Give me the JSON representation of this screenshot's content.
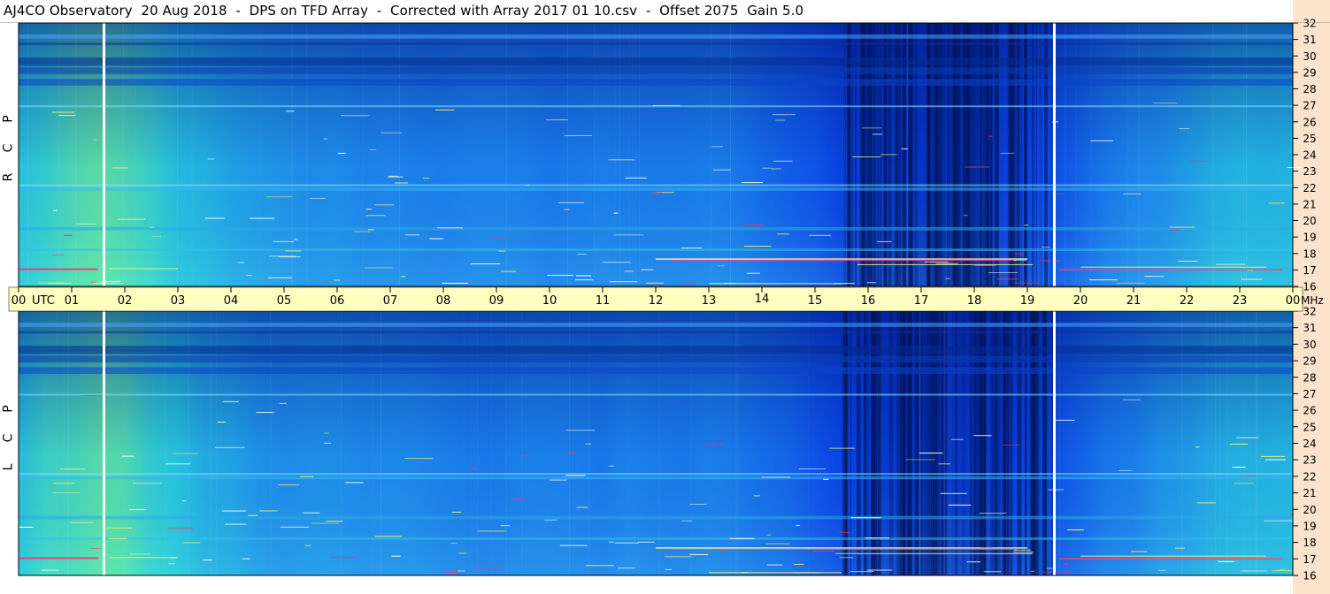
{
  "title": "AJ4CO Observatory  20 Aug 2018  -  DPS on TFD Array  -  Corrected with Array 2017 01 10.csv  -  Offset 2075  Gain 5.0",
  "colors": {
    "dark": "#00104a",
    "blue": "#0a3fe0",
    "mid": "#1e8cf0",
    "cyan": "#28d4e0",
    "green": "#7ff28a",
    "yellow": "#f5f070",
    "magenta": "#ff3070",
    "time_bar": "#ffffc0",
    "right_margin": "#fde3cc"
  },
  "chart_data": {
    "type": "heatmap",
    "title": "AJ4CO Observatory  20 Aug 2018  -  DPS on TFD Array  -  Corrected with Array 2017 01 10.csv  -  Offset 2075  Gain 5.0",
    "xlabel": "UTC",
    "ylabel": "MHz",
    "x_range": [
      0,
      24
    ],
    "y_range": [
      16,
      32
    ],
    "x_ticks": [
      "00",
      "01",
      "02",
      "03",
      "04",
      "05",
      "06",
      "07",
      "08",
      "09",
      "10",
      "11",
      "12",
      "13",
      "14",
      "15",
      "16",
      "17",
      "18",
      "19",
      "20",
      "21",
      "22",
      "23",
      "00"
    ],
    "y_ticks": [
      "16",
      "17",
      "18",
      "19",
      "20",
      "21",
      "22",
      "23",
      "24",
      "25",
      "26",
      "27",
      "28",
      "29",
      "30",
      "31",
      "32"
    ],
    "x_unit_label": "UTC",
    "y_unit_label": "MHz",
    "marker_times_utc": [
      1.6,
      19.5
    ],
    "panels": [
      {
        "name": "R C P",
        "letters": [
          "R",
          "C",
          "P"
        ]
      },
      {
        "name": "L C P",
        "letters": [
          "L",
          "C",
          "P"
        ]
      }
    ]
  }
}
